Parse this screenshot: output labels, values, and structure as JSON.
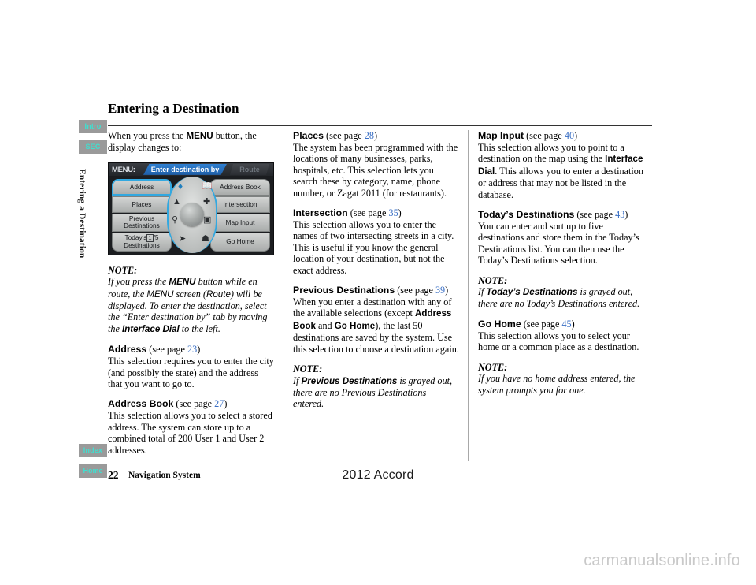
{
  "side_tabs": {
    "top": [
      {
        "label": "Intro",
        "name": "sidebar-tab-intro"
      },
      {
        "label": "SEC",
        "name": "sidebar-tab-sec"
      }
    ],
    "bottom": [
      {
        "label": "Index",
        "name": "sidebar-tab-index"
      },
      {
        "label": "Home",
        "name": "sidebar-tab-home"
      }
    ],
    "tab_bg_color": "#9a9a9a",
    "tab_text_color": "#3fe0d0"
  },
  "running_head": "Entering a Destination",
  "page_title": "Entering a Destination",
  "column1": {
    "intro": {
      "part1": "When you press the ",
      "ui1": "MENU",
      "part2": " button, the display changes to:"
    },
    "nav_screen": {
      "menu_label": "MENU:",
      "tab_active": "Enter destination by",
      "tab_inactive": "Route",
      "left_buttons": [
        "Address",
        "Places",
        "Previous\nDestinations",
        "Today's |1|/5\nDestinations"
      ],
      "left_button_1": "Address",
      "left_button_2": "Places",
      "left_button_3_line1": "Previous",
      "left_button_3_line2": "Destinations",
      "left_button_4_prefix": "Today's",
      "left_button_4_count": "1",
      "left_button_4_total": "/5",
      "left_button_4_line2": "Destinations",
      "right_buttons": [
        "Address Book",
        "Intersection",
        "Map Input",
        "Go Home"
      ],
      "right_button_1": "Address Book",
      "right_button_2": "Intersection",
      "right_button_3": "Map Input",
      "right_button_4": "Go Home",
      "icons": [
        "gem-icon",
        "address-book-icon",
        "road-icon",
        "intersection-icon",
        "magnifier-map-icon",
        "map-icon",
        "pin-route-icon",
        "house-icon"
      ],
      "selected_button": "Address"
    },
    "note1": {
      "label": "NOTE:",
      "seg1": "If you press the ",
      "ui1": "MENU",
      "seg2": " button while en route, the ",
      "ui2": "MENU",
      "seg3": " screen (",
      "ui3": "Route",
      "seg4": ") will be displayed. To enter the destination, select the “Enter destination by” tab by moving the ",
      "ui4": "Interface Dial",
      "seg5": " to the left."
    },
    "address": {
      "heading": "Address",
      "ref_open": " (see page ",
      "page": "23",
      "ref_close": ")",
      "body": "This selection requires you to enter the city (and possibly the state) and the address that you want to go to."
    },
    "address_book": {
      "heading": "Address Book",
      "ref_open": " (see page ",
      "page": "27",
      "ref_close": ")",
      "body": "This selection allows you to select a stored address. The system can store up to a combined total of 200 User 1 and User 2 addresses."
    }
  },
  "column2": {
    "places": {
      "heading": "Places",
      "ref_open": " (see page ",
      "page": "28",
      "ref_close": ")",
      "body": "The system has been programmed with the locations of many businesses, parks, hospitals, etc. This selection lets you search these by category, name, phone number, or Zagat 2011 (for restaurants)."
    },
    "intersection": {
      "heading": "Intersection",
      "ref_open": " (see page ",
      "page": "35",
      "ref_close": ")",
      "body": "This selection allows you to enter the names of two intersecting streets in a city. This is useful if you know the general location of your destination, but not the exact address."
    },
    "previous_destinations": {
      "heading": "Previous Destinations",
      "ref_open": " (see page ",
      "page": "39",
      "ref_close": ")",
      "seg1": "When you enter a destination with any of the available selections (except ",
      "ui1": "Address Book",
      "seg2": " and ",
      "ui2": "Go Home",
      "seg3": "), the last 50 destinations are saved by the system. Use this selection to choose a destination again."
    },
    "note2": {
      "label": "NOTE:",
      "seg1": "If ",
      "ui1": "Previous Destinations",
      "seg2": " is grayed out, there are no Previous Destinations entered."
    }
  },
  "column3": {
    "map_input": {
      "heading": "Map Input",
      "ref_open": " (see page ",
      "page": "40",
      "ref_close": ")",
      "seg1": "This selection allows you to point to a destination on the map using the ",
      "ui1": "Interface Dial",
      "seg2": ". This allows you to enter a destination or address that may not be listed in the database."
    },
    "todays_destinations": {
      "heading": "Today’s Destinations",
      "ref_open": " (see page ",
      "page": "43",
      "ref_close": ")",
      "body": "You can enter and sort up to five destinations and store them in the Today’s Destinations list. You can then use the Today’s Destinations selection."
    },
    "note3": {
      "label": "NOTE:",
      "seg1": "If ",
      "ui1": "Today’s Destinations",
      "seg2": " is grayed out, there are no Today’s Destinations entered."
    },
    "go_home": {
      "heading": "Go Home",
      "ref_open": " (see page ",
      "page": "45",
      "ref_close": ")",
      "body": "This selection allows you to select your home or a common place as a destination."
    },
    "note4": {
      "label": "NOTE:",
      "body": "If you have no home address entered, the system prompts you for one."
    }
  },
  "footer": {
    "home_tab": "Home",
    "page_number": "22",
    "section_label": "Navigation System",
    "model": "2012 Accord",
    "watermark": "carmanualsonline.info"
  }
}
